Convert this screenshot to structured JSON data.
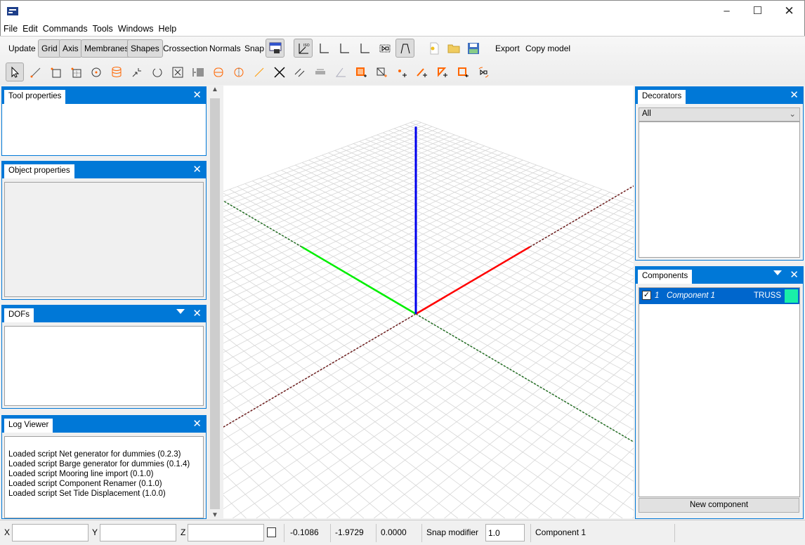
{
  "window": {
    "controls": [
      "minimize",
      "maximize",
      "close"
    ]
  },
  "menu": [
    "File",
    "Edit",
    "Commands",
    "Tools",
    "Windows",
    "Help"
  ],
  "toolbar": {
    "update": "Update",
    "grid": "Grid",
    "axis": "Axis",
    "membranes": "Membranes",
    "shapes": "Shapes",
    "crossection": "Crossection",
    "normals": "Normals",
    "snap": "Snap",
    "export": "Export",
    "copy_model": "Copy model",
    "toggled": [
      "Grid",
      "Axis",
      "Membranes",
      "Shapes"
    ],
    "iso_label": "ISO"
  },
  "panels": {
    "tool_properties": "Tool properties",
    "object_properties": "Object properties",
    "dofs": "DOFs",
    "log_viewer": "Log Viewer",
    "log_lines": [
      "Loaded script Net generator for dummies (0.2.3)",
      "Loaded script Barge generator for dummies (0.1.4)",
      "Loaded script Mooring line import (0.1.0)",
      "Loaded script Component Renamer (0.1.0)",
      "Loaded script Set Tide Displacement (1.0.0)"
    ],
    "decorators": "Decorators",
    "decorators_filter": "All",
    "components": "Components",
    "component_rows": [
      {
        "index": "1",
        "name": "Component 1",
        "type": "TRUSS",
        "checked": true,
        "color": "#19f0a8"
      }
    ],
    "new_component": "New component"
  },
  "viewport": {
    "axis_colors": {
      "x": "#ff0000",
      "y": "#00ee00",
      "z": "#0000ee",
      "neg_x": "#6b1a1a",
      "neg_y": "#1e6b1e"
    },
    "grid_color": "#d6d6d6"
  },
  "status": {
    "x_label": "X",
    "y_label": "Y",
    "z_label": "Z",
    "x_value": "",
    "y_value": "",
    "z_value": "",
    "coord1": "-0.1086",
    "coord2": "-1.9729",
    "coord3": "0.0000",
    "snap_modifier_label": "Snap modifier",
    "snap_modifier": "1.0",
    "active_component": "Component 1"
  },
  "colors": {
    "accent": "#0078d7",
    "selection": "#0066cc"
  }
}
